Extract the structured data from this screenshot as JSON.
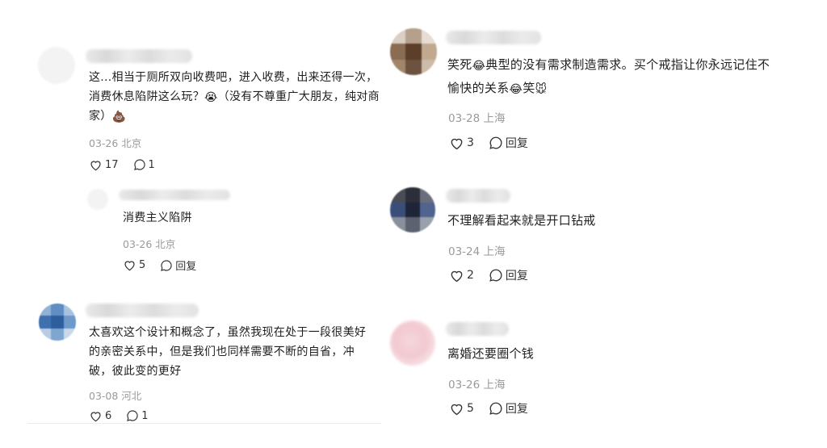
{
  "left": [
    {
      "text": "这...相当于厕所双向收费吧，进入收费，出来还得一次，消费休息陷阱这么玩？",
      "emoji1": "😭",
      "text2": "（没有不尊重广大朋友，纯对商家）",
      "emoji2": "💩",
      "meta": "03-26 北京",
      "likes": "17",
      "replies": "1"
    },
    {
      "text": "消费主义陷阱",
      "meta": "03-26 北京",
      "likes": "5",
      "replies": "回复"
    },
    {
      "text": "太喜欢这个设计和概念了，虽然我现在处于一段很美好的亲密关系中，但是我们也同样需要不断的自省，冲破，彼此变的更好",
      "meta": "03-08 河北",
      "likes": "6",
      "replies": "1"
    }
  ],
  "right": [
    {
      "text_a": "笑死",
      "emoji_a": "😂",
      "text_b": "典型的没有需求制造需求。买个戒指让你永远记住不愉快的关系",
      "emoji_b": "😂",
      "text_c": "笑",
      "emoji_c": "🐭",
      "meta": "03-28 上海",
      "likes": "3",
      "replies": "回复"
    },
    {
      "text": "不理解看起来就是开口钻戒",
      "meta": "03-24 上海",
      "likes": "2",
      "replies": "回复"
    },
    {
      "text": "离婚还要圈个钱",
      "meta": "03-26 上海",
      "likes": "5",
      "replies": "回复"
    }
  ],
  "icons": {
    "like": "heart-outline-icon",
    "reply": "speech-bubble-outline-icon"
  }
}
